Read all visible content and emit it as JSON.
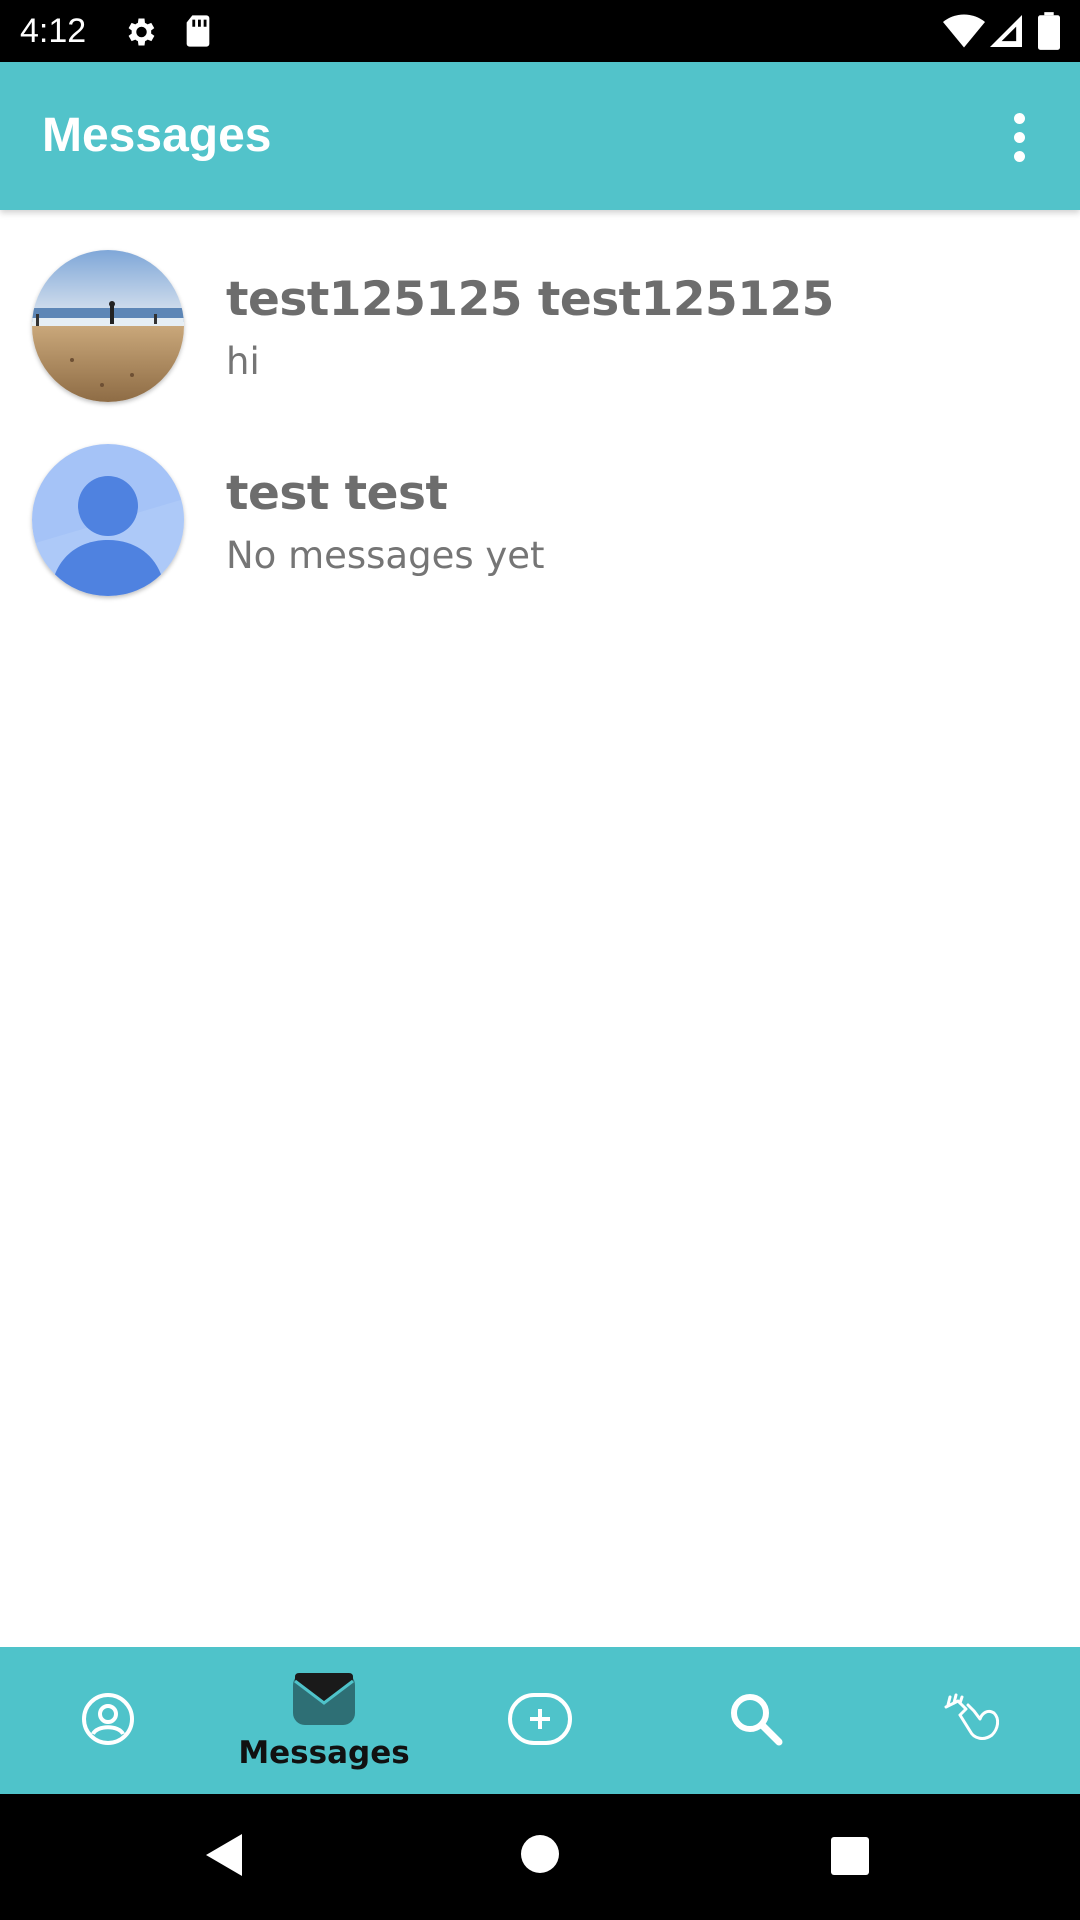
{
  "status_bar": {
    "time": "4:12",
    "icons": [
      "gear-icon",
      "sd-card-icon",
      "wifi-icon",
      "signal-icon",
      "battery-icon"
    ]
  },
  "app_bar": {
    "title": "Messages",
    "menu_icon": "overflow-menu-icon"
  },
  "conversations": [
    {
      "name": "test125125 test125125",
      "preview": "hi",
      "avatar": "beach-photo-avatar"
    },
    {
      "name": "test test",
      "preview": "No messages yet",
      "avatar": "default-person-avatar"
    }
  ],
  "bottom_nav": {
    "items": [
      {
        "icon": "profile-icon",
        "label": ""
      },
      {
        "icon": "mail-icon",
        "label": "Messages",
        "active": true
      },
      {
        "icon": "add-circle-icon",
        "label": ""
      },
      {
        "icon": "search-icon",
        "label": ""
      },
      {
        "icon": "flexed-arm-icon",
        "label": ""
      }
    ]
  },
  "colors": {
    "app_bar": "#52c3ca",
    "bottom_nav": "#4fc3ca",
    "active_icon": "#2e6f75",
    "text_primary": "#6d6d6d",
    "text_secondary": "#757575"
  }
}
